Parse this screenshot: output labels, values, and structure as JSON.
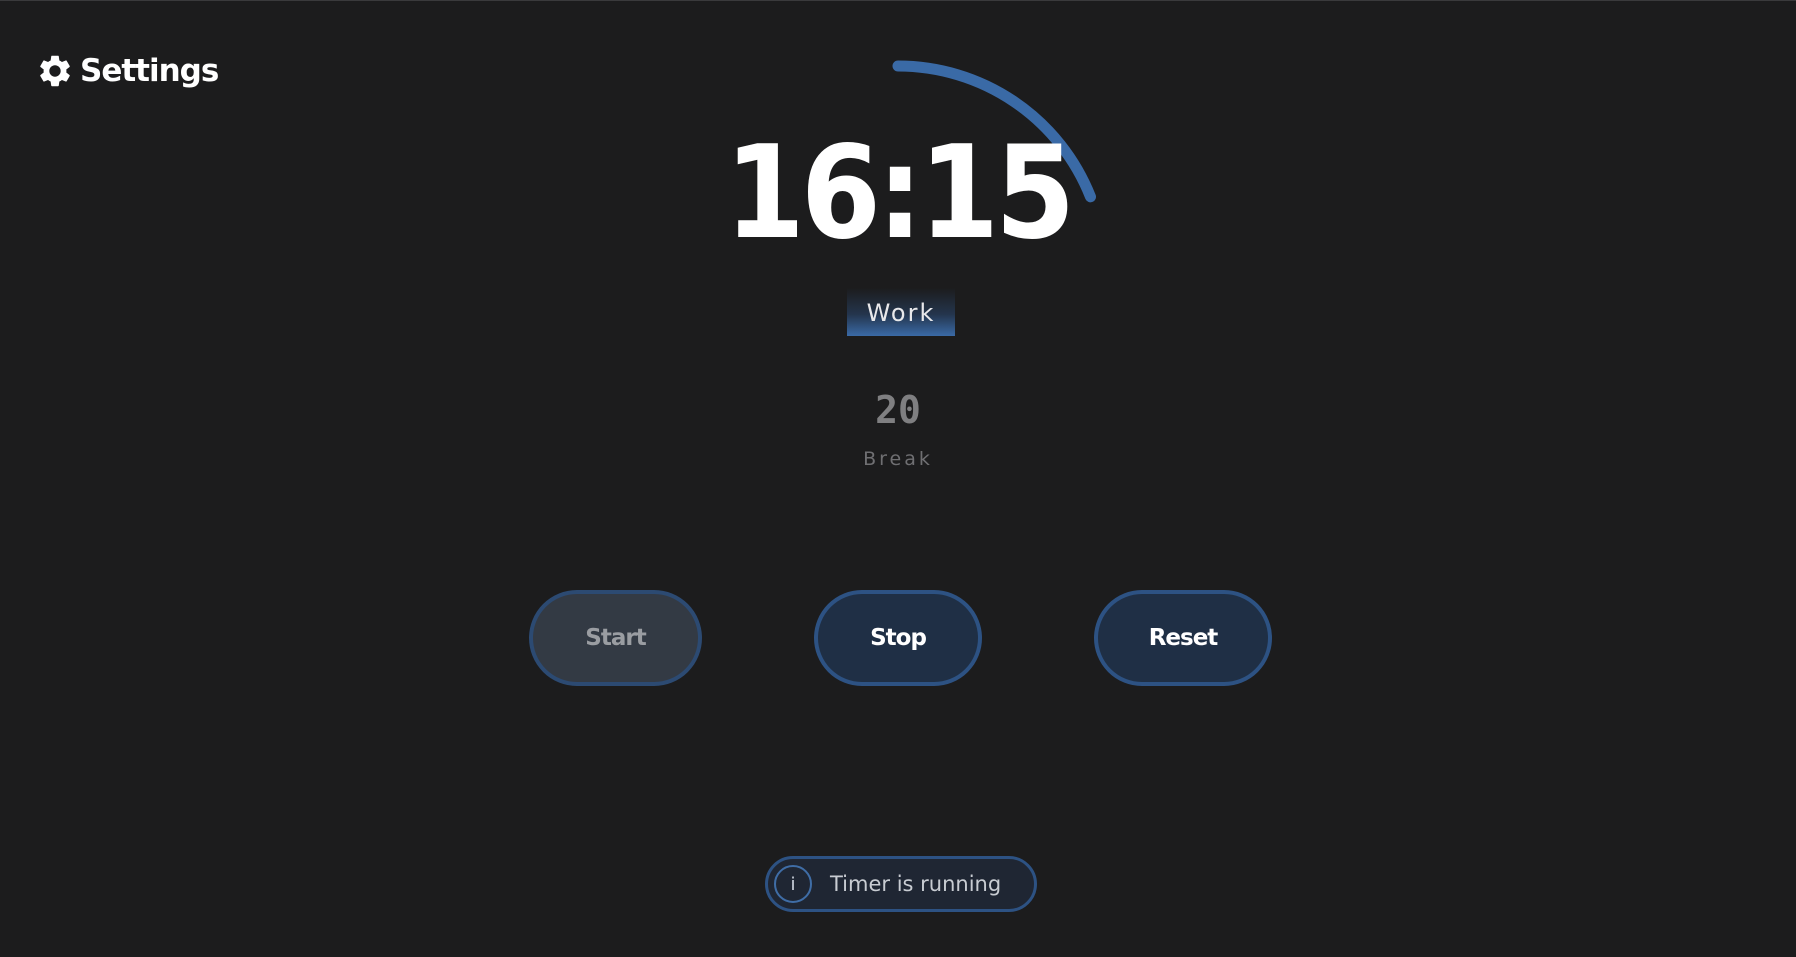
{
  "header": {
    "settings_label": "Settings",
    "settings_icon": "gear-icon"
  },
  "timer": {
    "time": "16:15",
    "mode": "Work",
    "progress_fraction": 0.19
  },
  "next": {
    "count": "20",
    "label": "Break"
  },
  "controls": {
    "start_label": "Start",
    "stop_label": "Stop",
    "reset_label": "Reset"
  },
  "status": {
    "icon": "info-icon",
    "icon_glyph": "i",
    "text": "Timer is running"
  },
  "colors": {
    "background": "#1c1c1d",
    "accent": "#3a6aa6",
    "button_fill": "#1f2f45",
    "button_border": "#2d5283"
  }
}
